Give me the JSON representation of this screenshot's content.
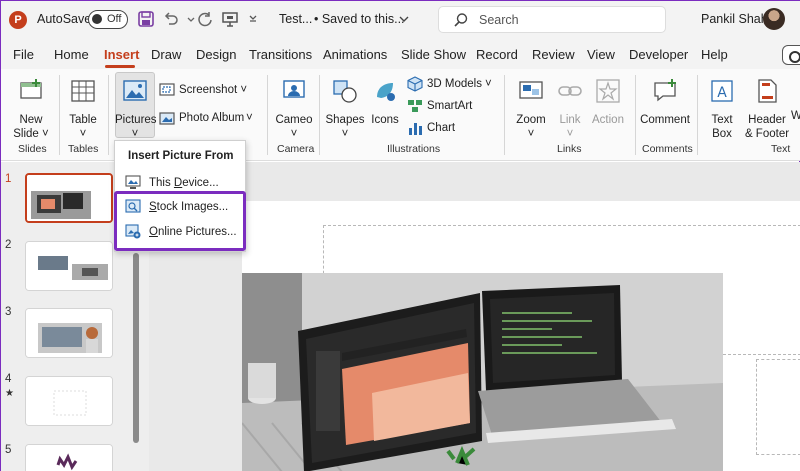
{
  "titlebar": {
    "app_icon": "P",
    "autosave_label": "AutoSave",
    "autosave_toggle": "Off",
    "icons": [
      "save-icon",
      "undo-icon",
      "redo-icon",
      "present-icon"
    ],
    "doc_title": "Test...",
    "doc_saved": "•  Saved to this...",
    "search_placeholder": "Search",
    "user_name": "Pankil Shah"
  },
  "menu": {
    "tabs": [
      "File",
      "Home",
      "Insert",
      "Draw",
      "Design",
      "Transitions",
      "Animations",
      "Slide Show",
      "Record",
      "Review",
      "View",
      "Developer",
      "Help"
    ],
    "active": "Insert"
  },
  "ribbon": {
    "new_slide": {
      "line1": "New",
      "line2": "Slide"
    },
    "table": "Table",
    "pictures": "Pictures",
    "screenshot": "Screenshot",
    "photo_album": "Photo Album",
    "cameo": "Cameo",
    "shapes": "Shapes",
    "icons": "Icons",
    "models_3d": "3D Models",
    "smartart": "SmartArt",
    "chart": "Chart",
    "zoom": "Zoom",
    "link": "Link",
    "action": "Action",
    "comment": "Comment",
    "text_box": {
      "line1": "Text",
      "line2": "Box"
    },
    "header_footer": {
      "line1": "Header",
      "line2": "& Footer"
    },
    "wordart_partial": "W",
    "groups": {
      "slides": "Slides",
      "tables": "Tables",
      "camera": "Camera",
      "illustrations": "Illustrations",
      "links": "Links",
      "comments": "Comments",
      "text": "Text"
    }
  },
  "dropdown": {
    "title": "Insert Picture From",
    "items": [
      {
        "label": "This Device...",
        "underline": "D",
        "before": "This ",
        "after": "evice..."
      },
      {
        "label": "Stock Images...",
        "underline": "S",
        "before": "",
        "after": "tock Images..."
      },
      {
        "label": "Online Pictures...",
        "underline": "O",
        "before": "",
        "after": "nline Pictures..."
      }
    ]
  },
  "slides": {
    "numbers": [
      "1",
      "2",
      "3",
      "4",
      "5"
    ],
    "star_marker": "★"
  },
  "colors": {
    "accent": "#c43e1c",
    "highlight": "#7b2cbf"
  }
}
